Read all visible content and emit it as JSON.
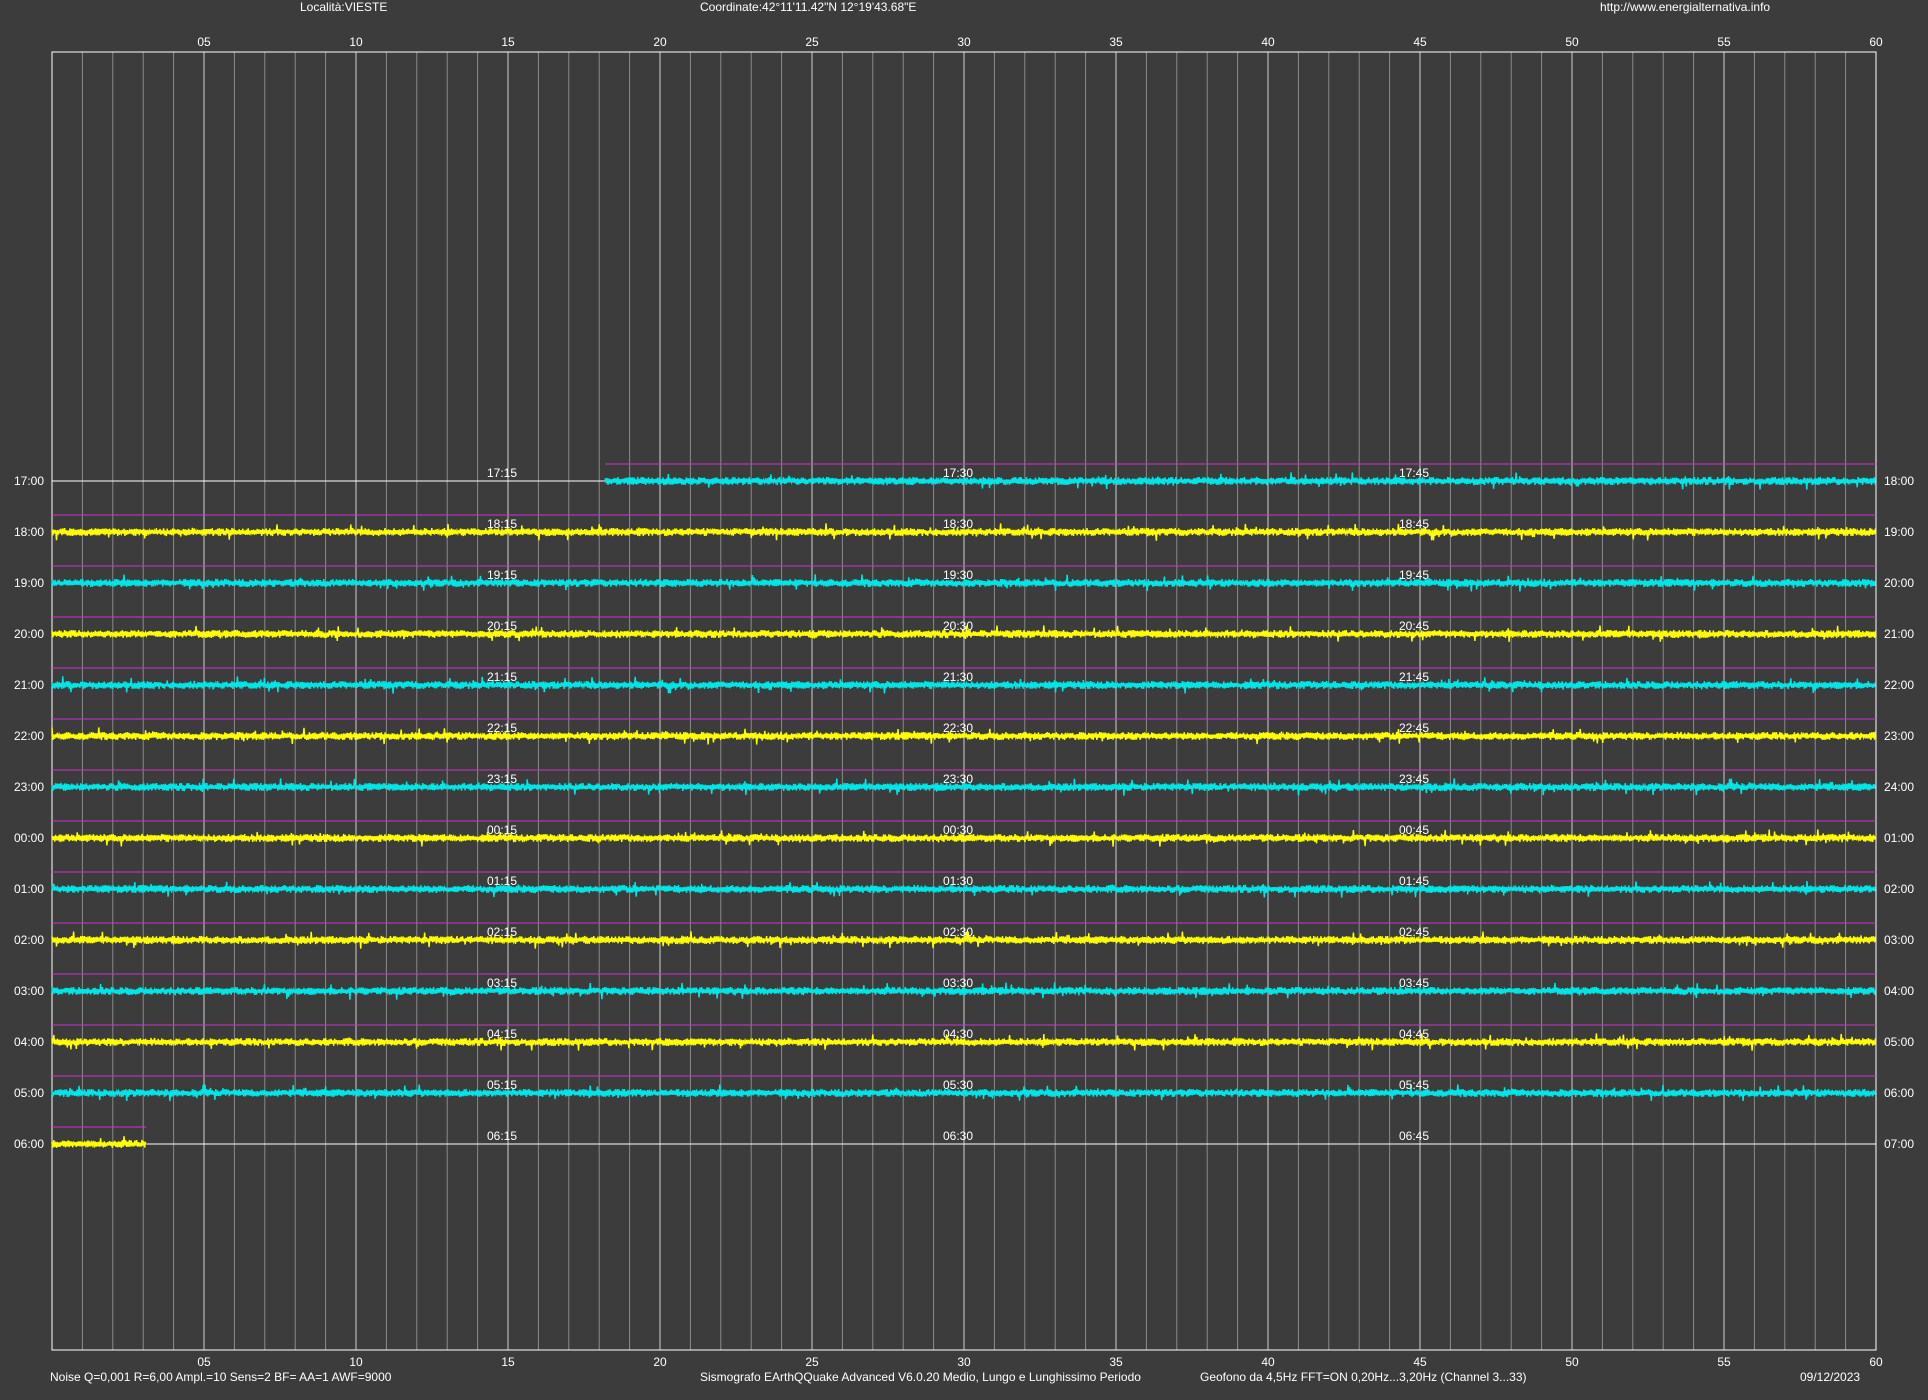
{
  "header": {
    "location": "Località:VIESTE",
    "coordinates": "Coordinate:42°11'11.42\"N  12°19'43.68\"E",
    "website": "http://www.energialternativa.info"
  },
  "footer": {
    "noise": "Noise Q=0,001 R=6,00 Ampl.=10 Sens=2 BF= AA=1 AWF=9000",
    "software": "Sismografo  EArthQQuake Advanced V6.0.20  Medio, Lungo e Lunghissimo Periodo",
    "geofono": "Geofono da 4,5Hz FFT=ON 0,20Hz...3,20Hz      (Channel 3...33)",
    "date": "09/12/2023"
  },
  "colors": {
    "background": "#3c3c3c",
    "plot_border": "#ffffff",
    "major_grid": "#d0d0d0",
    "minor_grid": "#8a8a8a",
    "guide_line": "#cc33cc",
    "trace_cyan": "#00e5e5",
    "trace_yellow": "#ffff00",
    "text": "#ffffff"
  },
  "chart_data": {
    "type": "line",
    "xlim": [
      0,
      60
    ],
    "x_tick_labels": [
      "05",
      "10",
      "15",
      "20",
      "25",
      "30",
      "35",
      "40",
      "45",
      "50",
      "55",
      "60"
    ],
    "minor_tick_step": 1,
    "rows": [
      {
        "left": "17:00",
        "right": "18:00",
        "marks": [
          "17:15",
          "17:30",
          "17:45"
        ],
        "color": "cyan",
        "start_min": 18.2,
        "end_min": 60
      },
      {
        "left": "18:00",
        "right": "19:00",
        "marks": [
          "18:15",
          "18:30",
          "18:45"
        ],
        "color": "yellow",
        "start_min": 0,
        "end_min": 60
      },
      {
        "left": "19:00",
        "right": "20:00",
        "marks": [
          "19:15",
          "19:30",
          "19:45"
        ],
        "color": "cyan",
        "start_min": 0,
        "end_min": 60
      },
      {
        "left": "20:00",
        "right": "21:00",
        "marks": [
          "20:15",
          "20:30",
          "20:45"
        ],
        "color": "yellow",
        "start_min": 0,
        "end_min": 60
      },
      {
        "left": "21:00",
        "right": "22:00",
        "marks": [
          "21:15",
          "21:30",
          "21:45"
        ],
        "color": "cyan",
        "start_min": 0,
        "end_min": 60
      },
      {
        "left": "22:00",
        "right": "23:00",
        "marks": [
          "22:15",
          "22:30",
          "22:45"
        ],
        "color": "yellow",
        "start_min": 0,
        "end_min": 60
      },
      {
        "left": "23:00",
        "right": "24:00",
        "marks": [
          "23:15",
          "23:30",
          "23:45"
        ],
        "color": "cyan",
        "start_min": 0,
        "end_min": 60
      },
      {
        "left": "00:00",
        "right": "01:00",
        "marks": [
          "00:15",
          "00:30",
          "00:45"
        ],
        "color": "yellow",
        "start_min": 0,
        "end_min": 60
      },
      {
        "left": "01:00",
        "right": "02:00",
        "marks": [
          "01:15",
          "01:30",
          "01:45"
        ],
        "color": "cyan",
        "start_min": 0,
        "end_min": 60
      },
      {
        "left": "02:00",
        "right": "03:00",
        "marks": [
          "02:15",
          "02:30",
          "02:45"
        ],
        "color": "yellow",
        "start_min": 0,
        "end_min": 60
      },
      {
        "left": "03:00",
        "right": "04:00",
        "marks": [
          "03:15",
          "03:30",
          "03:45"
        ],
        "color": "cyan",
        "start_min": 0,
        "end_min": 60
      },
      {
        "left": "04:00",
        "right": "05:00",
        "marks": [
          "04:15",
          "04:30",
          "04:45"
        ],
        "color": "yellow",
        "start_min": 0,
        "end_min": 60
      },
      {
        "left": "05:00",
        "right": "06:00",
        "marks": [
          "05:15",
          "05:30",
          "05:45"
        ],
        "color": "cyan",
        "start_min": 0,
        "end_min": 60
      },
      {
        "left": "06:00",
        "right": "07:00",
        "marks": [
          "06:15",
          "06:30",
          "06:45"
        ],
        "color": "yellow",
        "start_min": 0,
        "end_min": 3.1
      }
    ]
  }
}
